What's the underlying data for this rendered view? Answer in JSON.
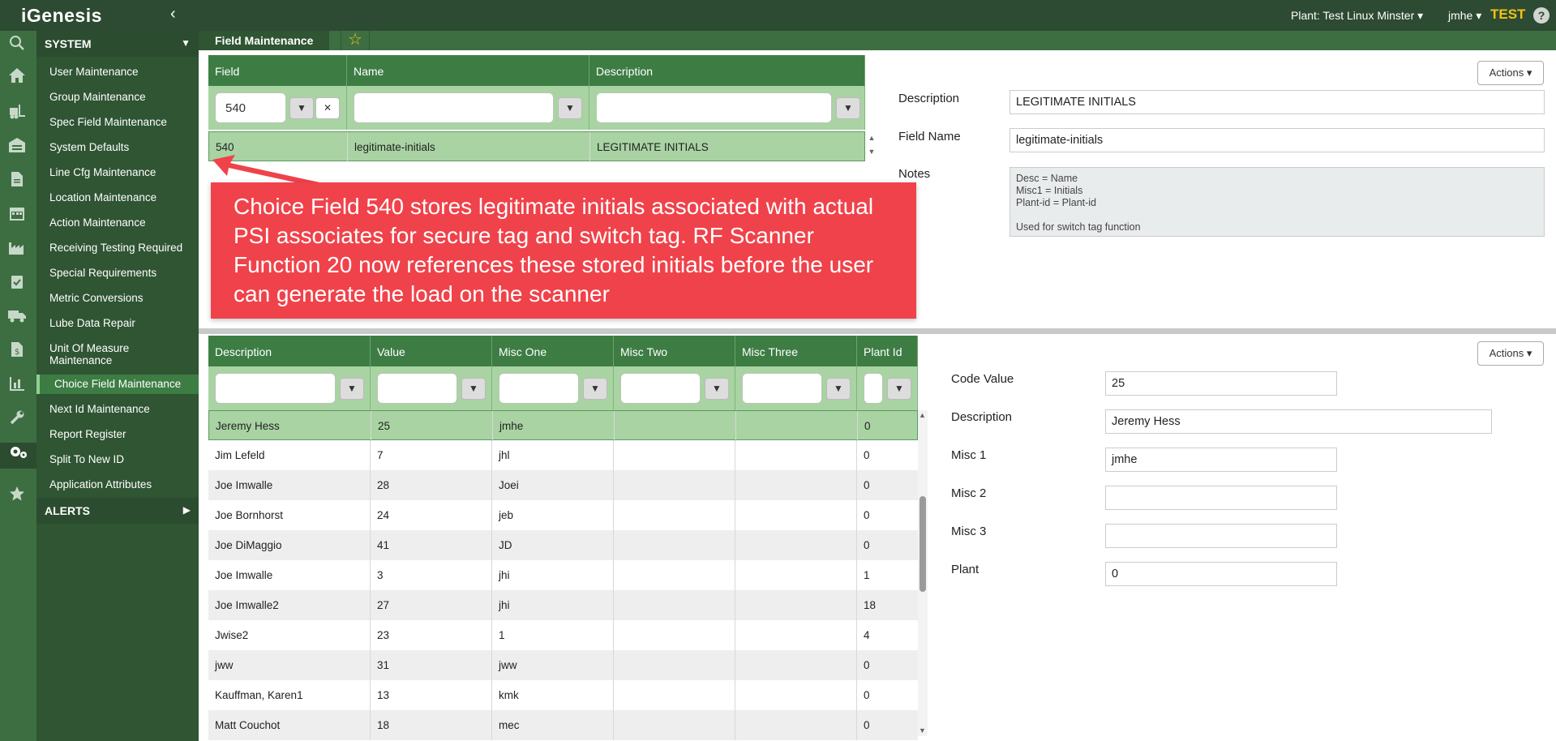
{
  "topbar": {
    "logo": "iGenesis",
    "collapse_glyph": "‹",
    "plant": "Plant: Test Linux Minster ▾",
    "user": "jmhe ▾",
    "env": "TEST",
    "help": "?"
  },
  "rail": {
    "icons": [
      "search-icon",
      "home-icon",
      "forklift-icon",
      "warehouse-icon",
      "document-icon",
      "calendar-icon",
      "factory-icon",
      "clipboard-check-icon",
      "truck-icon",
      "invoice-icon",
      "report-icon",
      "wrench-icon",
      "gears-icon",
      "star-icon"
    ]
  },
  "sidebar": {
    "system_label": "SYSTEM",
    "alerts_label": "ALERTS",
    "items": [
      "User Maintenance",
      "Group Maintenance",
      "Spec Field Maintenance",
      "System Defaults",
      "Line Cfg Maintenance",
      "Location Maintenance",
      "Action Maintenance",
      "Receiving Testing Required",
      "Special Requirements",
      "Metric Conversions",
      "Lube Data Repair",
      "Unit Of Measure Maintenance",
      "Choice Field Maintenance",
      "Next Id Maintenance",
      "Report Register",
      "Split To New ID",
      "Application Attributes"
    ],
    "active_item": "Choice Field Maintenance"
  },
  "tab": {
    "title": "Field Maintenance"
  },
  "field_grid": {
    "columns": [
      "Field",
      "Name",
      "Description"
    ],
    "filter_values": [
      "540",
      "",
      ""
    ],
    "rows": [
      [
        "540",
        "legitimate-initials",
        "LEGITIMATE INITIALS"
      ]
    ]
  },
  "field_form": {
    "actions_label": "Actions ▾",
    "description_label": "Description",
    "description_value": "LEGITIMATE INITIALS",
    "fieldname_label": "Field Name",
    "fieldname_value": "legitimate-initials",
    "notes_label": "Notes",
    "notes_value": "Desc = Name\nMisc1 = Initials\nPlant-id = Plant-id\n\nUsed for switch tag function"
  },
  "callout": {
    "text": "Choice Field 540 stores legitimate initials associated with actual PSI associates for secure tag and switch tag. RF Scanner Function 20 now references these stored initials before the user can generate the load on the scanner"
  },
  "value_grid": {
    "columns": [
      "Description",
      "Value",
      "Misc One",
      "Misc Two",
      "Misc Three",
      "Plant Id"
    ],
    "rows": [
      [
        "Jeremy Hess",
        "25",
        "jmhe",
        "",
        "",
        "0"
      ],
      [
        "Jim Lefeld",
        "7",
        "jhl",
        "",
        "",
        "0"
      ],
      [
        "Joe Imwalle",
        "28",
        "Joei",
        "",
        "",
        "0"
      ],
      [
        "Joe Bornhorst",
        "24",
        "jeb",
        "",
        "",
        "0"
      ],
      [
        "Joe DiMaggio",
        "41",
        "JD",
        "",
        "",
        "0"
      ],
      [
        "Joe Imwalle",
        "3",
        "jhi",
        "",
        "",
        "1"
      ],
      [
        "Joe Imwalle2",
        "27",
        "jhi",
        "",
        "",
        "18"
      ],
      [
        "Jwise2",
        "23",
        "1",
        "",
        "",
        "4"
      ],
      [
        "jww",
        "31",
        "jww",
        "",
        "",
        "0"
      ],
      [
        "Kauffman, Karen1",
        "13",
        "kmk",
        "",
        "",
        "0"
      ],
      [
        "Matt Couchot",
        "18",
        "mec",
        "",
        "",
        "0"
      ]
    ]
  },
  "value_form": {
    "actions_label": "Actions ▾",
    "code_value_label": "Code Value",
    "code_value": "25",
    "description_label": "Description",
    "description_value": "Jeremy Hess",
    "misc1_label": "Misc 1",
    "misc1_value": "jmhe",
    "misc2_label": "Misc 2",
    "misc2_value": "",
    "misc3_label": "Misc 3",
    "misc3_value": "",
    "plant_label": "Plant",
    "plant_value": "0"
  },
  "colors": {
    "topbar": "#2d4a32",
    "sidebar": "#2f5533",
    "header_green": "#3d7d44",
    "selected_row": "#a9d3a3",
    "callout_red": "#f0424a",
    "env_yellow": "#f1c40f"
  }
}
